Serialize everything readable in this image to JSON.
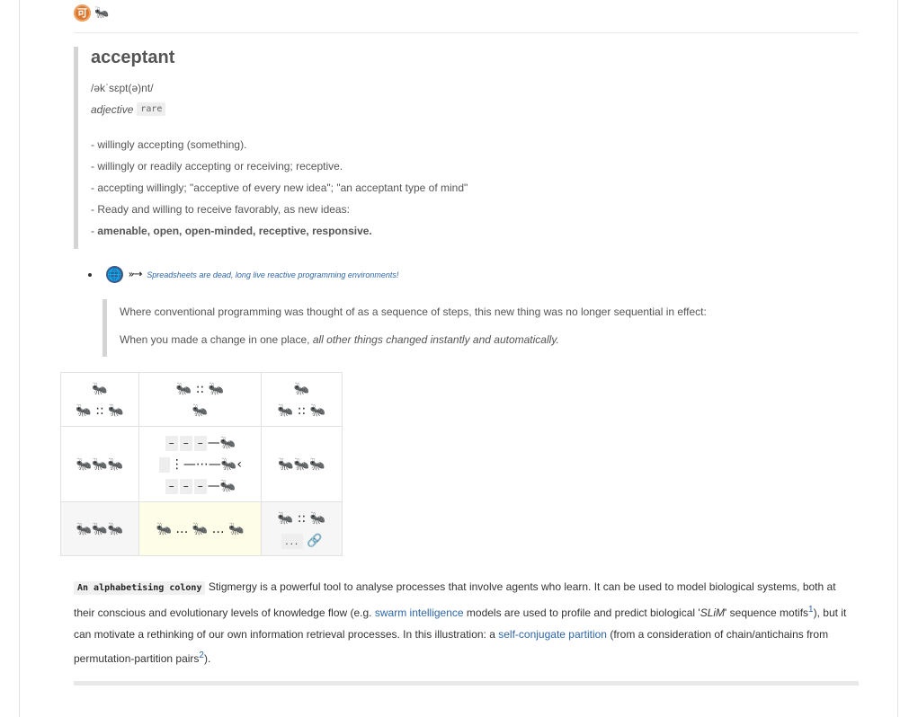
{
  "topbar": {
    "badge_glyph": "可",
    "ant_glyph": "🐜"
  },
  "definition": {
    "word": "acceptant",
    "pronunciation": "/əkˈsɛpt(ə)nt/",
    "part_of_speech": "adjective",
    "tag": "rare",
    "senses": [
      "- willingly accepting (something).",
      "- willingly or readily accepting or receiving; receptive.",
      "- accepting willingly; \"acceptive of every new idea\"; \"an acceptant type of mind\"",
      "- Ready and willing to receive favorably, as new ideas:"
    ],
    "synonyms_prefix": "- ",
    "synonyms": "amenable, open, open-minded, receptive, responsive."
  },
  "link_item": {
    "globe_glyph": "🌐",
    "arrows": "»·⇢",
    "link_text": "Spreadsheets are dead, long live reactive programming environments!"
  },
  "quote": {
    "line1": "Where conventional programming was thought of as a sequence of steps, this new thing was no longer sequential in effect:",
    "line2_prefix": "When you made a change in one place, ",
    "line2_emph": "all other things changed instantly and automatically."
  },
  "grid": {
    "r1c1_top": "🐜",
    "r1c1_bottom": "🐜 :: 🐜",
    "r1c2_top": "🐜 :: 🐜",
    "r1c2_bottom": "🐜",
    "r1c3_top": "🐜",
    "r1c3_bottom": "🐜 :: 🐜",
    "r2c1": "🐜🐜🐜",
    "r2c2_line1_tail": "—🐜",
    "r2c2_line2_tail": "⋮—⋯—🐜‹",
    "r2c2_line3_tail": "—🐜",
    "dash": "–",
    "r2c3": "🐜🐜🐜",
    "r3c1": "🐜🐜🐜",
    "r3c2": "🐜 … 🐜 … 🐜",
    "r3c3_top": "🐜 :: 🐜",
    "r3c3_dots": "...",
    "r3c3_link": "🔗"
  },
  "paragraph": {
    "label": "An alphabetising colony",
    "text1": " Stigmergy is a powerful tool to analyse processes that involve agents who learn. It can be used to model biological systems, both at their conscious and evolutionary levels of knowledge flow (e.g. ",
    "link1": "swarm intelligence",
    "text2": " models are used to profile and predict biological '",
    "slim": "SLiM",
    "text3": "' sequence motifs",
    "sup1": "1",
    "text4": "), but it can motivate a rethinking of our own information retrieval processes. In this illustration: a ",
    "link2": "self-conjugate partition",
    "text5": " (from a consideration of chain/antichains from permutation-partition pairs",
    "sup2": "2",
    "text6": ")."
  }
}
